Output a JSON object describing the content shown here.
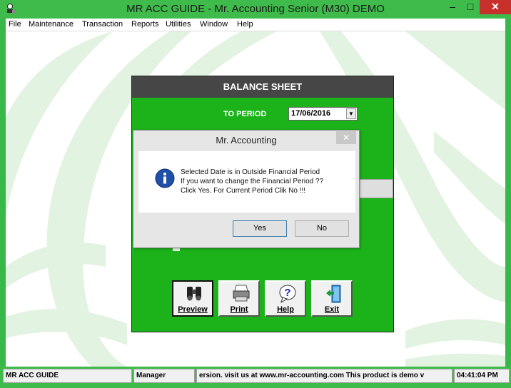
{
  "window": {
    "title": "MR ACC GUIDE - Mr. Accounting Senior (M30) DEMO",
    "min_glyph": "–",
    "max_glyph": "□",
    "close_glyph": "✕"
  },
  "menu": [
    "File",
    "Maintenance",
    "Transaction",
    "Reports",
    "Utilities",
    "Window",
    "Help"
  ],
  "balance_sheet": {
    "title": "BALANCE SHEET",
    "period_label": "TO PERIOD",
    "date_value": "17/06/2016",
    "buttons": {
      "preview": "Preview",
      "print": "Print",
      "help": "Help",
      "exit": "Exit"
    }
  },
  "dialog": {
    "title": "Mr. Accounting",
    "close_glyph": "✕",
    "lines": [
      "Selected Date is in Outside Financial Period",
      "If you want to change the Financial Period ??",
      "Click Yes. For Current Period Clik No !!!"
    ],
    "yes_label": "Yes",
    "no_label": "No"
  },
  "status": {
    "app": "MR ACC GUIDE",
    "user": "Manager",
    "message": "ersion.  visit us at www.mr-accounting.com This product is demo v",
    "time": "04:41:04 PM"
  },
  "colors": {
    "form_green": "#1cb21a",
    "chrome_green": "#3fbb4b",
    "header_gray": "#464646"
  }
}
